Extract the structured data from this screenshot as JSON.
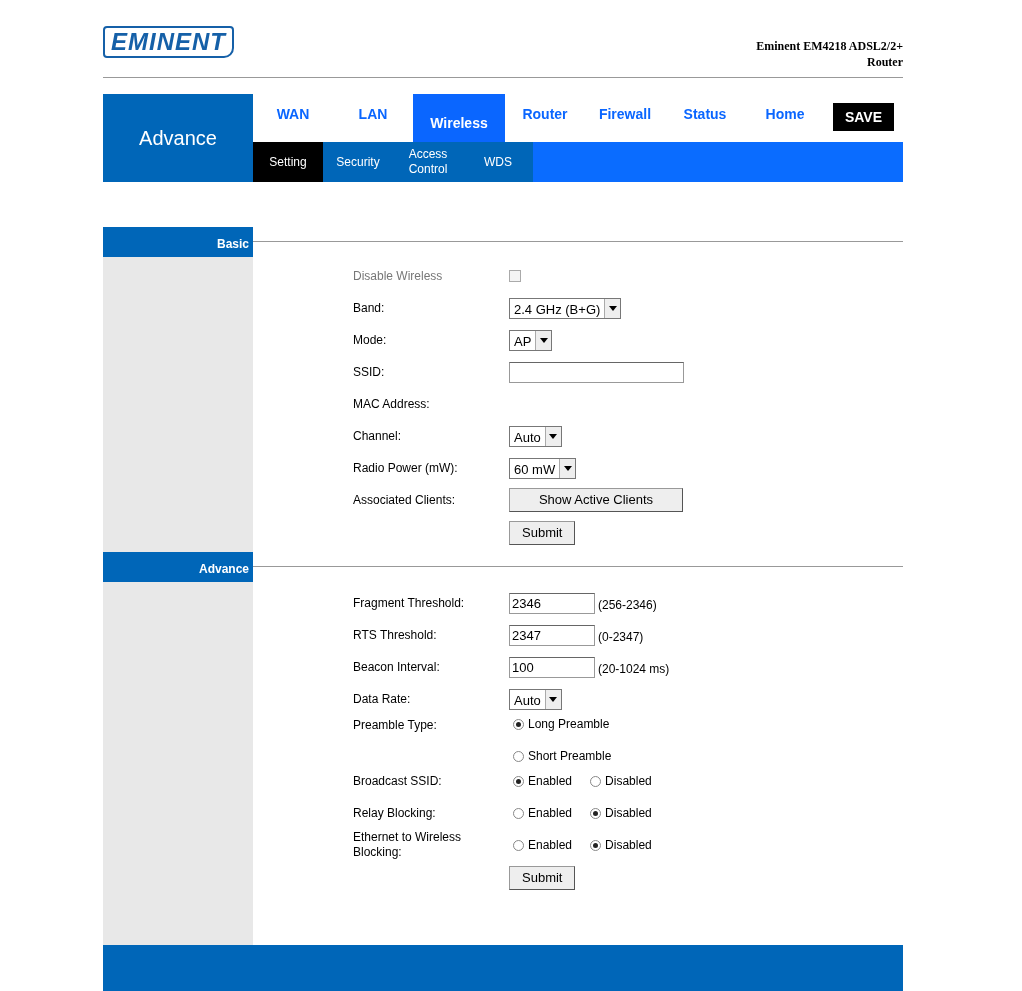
{
  "header": {
    "logo": "EMINENT",
    "product_title": "Eminent EM4218 ADSL2/2+ Router"
  },
  "nav": {
    "section_label": "Advance",
    "tabs": [
      {
        "label": "WAN",
        "selected": false
      },
      {
        "label": "LAN",
        "selected": false
      },
      {
        "label": "Wireless",
        "selected": true
      },
      {
        "label": "Router",
        "selected": false
      },
      {
        "label": "Firewall",
        "selected": false
      },
      {
        "label": "Status",
        "selected": false
      },
      {
        "label": "Home",
        "selected": false
      }
    ],
    "save_button": "SAVE",
    "subtabs": [
      {
        "label": "Setting",
        "selected": true
      },
      {
        "label": "Security",
        "selected": false
      },
      {
        "label": "Access Control",
        "selected": false
      },
      {
        "label": "WDS",
        "selected": false
      }
    ]
  },
  "sections": [
    {
      "title": "Basic",
      "rows": [
        {
          "kind": "checkbox",
          "label": "Disable Wireless",
          "checked": false,
          "disabled": true
        },
        {
          "kind": "select",
          "label": "Band:",
          "value": "2.4 GHz (B+G)"
        },
        {
          "kind": "select",
          "label": "Mode:",
          "value": "AP"
        },
        {
          "kind": "text",
          "label": "SSID:",
          "value": ""
        },
        {
          "kind": "static",
          "label": "MAC Address:"
        },
        {
          "kind": "select",
          "label": "Channel:",
          "value": "Auto"
        },
        {
          "kind": "select",
          "label": "Radio Power (mW):",
          "value": "60 mW"
        },
        {
          "kind": "button",
          "label": "Associated Clients:",
          "button": "Show Active Clients"
        },
        {
          "kind": "submit",
          "button": "Submit"
        }
      ]
    },
    {
      "title": "Advance",
      "rows": [
        {
          "kind": "number",
          "label": "Fragment Threshold:",
          "value": "2346",
          "hint": "(256-2346)"
        },
        {
          "kind": "number",
          "label": "RTS Threshold:",
          "value": "2347",
          "hint": "(0-2347)"
        },
        {
          "kind": "number",
          "label": "Beacon Interval:",
          "value": "100",
          "hint": "(20-1024 ms)"
        },
        {
          "kind": "select",
          "label": "Data Rate:",
          "value": "Auto"
        },
        {
          "kind": "radio-stacked",
          "label": "Preamble Type:",
          "options": [
            {
              "label": "Long Preamble",
              "selected": true
            },
            {
              "label": "Short Preamble",
              "selected": false
            }
          ]
        },
        {
          "kind": "radio",
          "label": "Broadcast SSID:",
          "options": [
            {
              "label": "Enabled",
              "selected": true
            },
            {
              "label": "Disabled",
              "selected": false
            }
          ]
        },
        {
          "kind": "radio",
          "label": "Relay Blocking:",
          "options": [
            {
              "label": "Enabled",
              "selected": false
            },
            {
              "label": "Disabled",
              "selected": true
            }
          ]
        },
        {
          "kind": "radio",
          "label": "Ethernet to Wireless Blocking:",
          "options": [
            {
              "label": "Enabled",
              "selected": false
            },
            {
              "label": "Disabled",
              "selected": true
            }
          ]
        },
        {
          "kind": "submit",
          "button": "Submit"
        }
      ]
    }
  ]
}
